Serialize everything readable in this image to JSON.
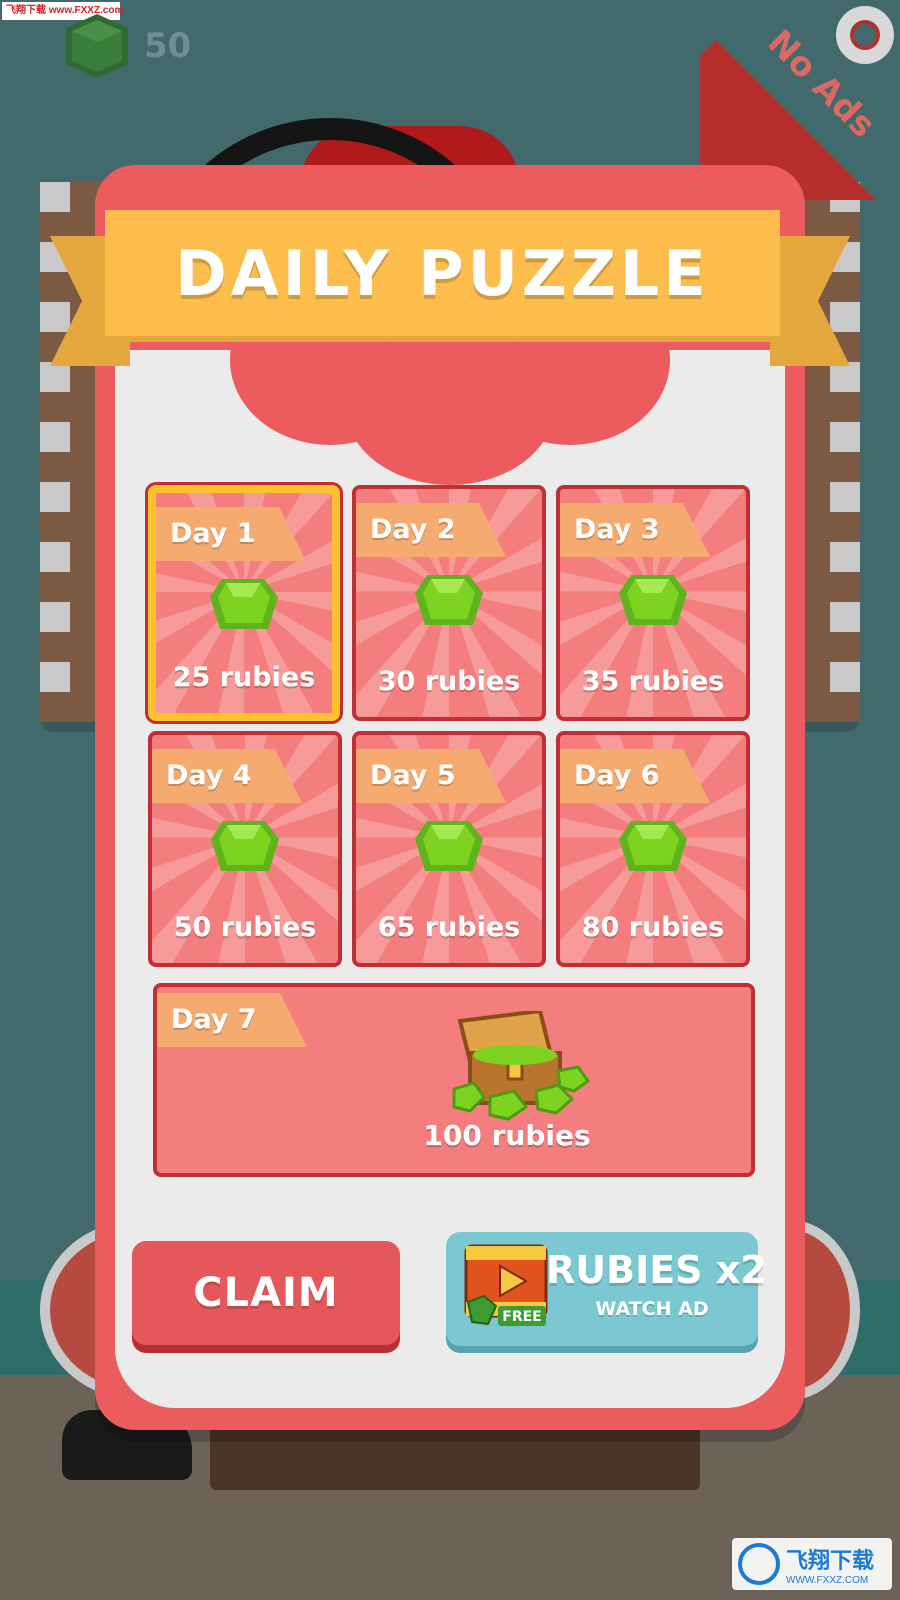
{
  "hud": {
    "ruby_count": "50",
    "no_ads_label": "No Ads"
  },
  "watermarks": {
    "top": "飞翔下载 www.FXXZ.com",
    "bottom_name": "飞翔下载",
    "bottom_url": "WWW.FXXZ.COM"
  },
  "dialog": {
    "title": "DAILY PUZZLE",
    "days": [
      {
        "label": "Day 1",
        "reward": "25 rubies",
        "selected": true
      },
      {
        "label": "Day 2",
        "reward": "30 rubies",
        "selected": false
      },
      {
        "label": "Day 3",
        "reward": "35 rubies",
        "selected": false
      },
      {
        "label": "Day 4",
        "reward": "50 rubies",
        "selected": false
      },
      {
        "label": "Day 5",
        "reward": "65 rubies",
        "selected": false
      },
      {
        "label": "Day 6",
        "reward": "80 rubies",
        "selected": false
      },
      {
        "label": "Day 7",
        "reward": "100 rubies",
        "selected": false
      }
    ],
    "claim_label": "CLAIM",
    "watch_ad": {
      "title": "RUBIES x2",
      "subtitle": "WATCH AD",
      "badge": "FREE"
    }
  },
  "colors": {
    "card": "#ec5b5e",
    "banner": "#fcbd4c",
    "tile": "#f47e7e",
    "selected_border": "#fcc12d",
    "gem": "#7ed321",
    "watch_ad_button": "#7bc8d2"
  },
  "icons": {
    "ruby": "green-gem-icon",
    "chest": "treasure-chest-icon",
    "video": "video-play-icon",
    "lifebuoy": "lifebuoy-icon"
  }
}
